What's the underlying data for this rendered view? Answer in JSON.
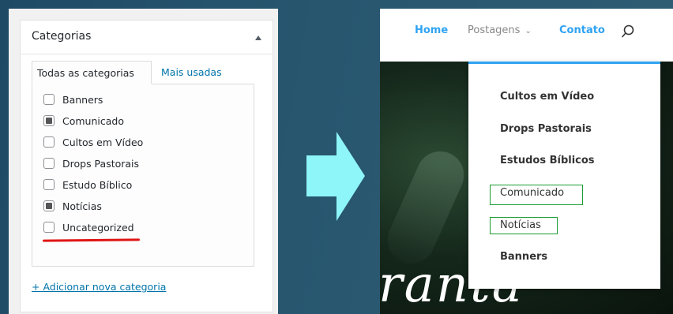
{
  "wp_panel": {
    "title": "Categorias",
    "tabs": [
      "Todas as categorias",
      "Mais usadas"
    ],
    "categories": [
      {
        "label": "Banners",
        "checked": false
      },
      {
        "label": "Comunicado",
        "checked": true
      },
      {
        "label": "Cultos em Vídeo",
        "checked": false
      },
      {
        "label": "Drops Pastorais",
        "checked": false
      },
      {
        "label": "Estudo Bíblico",
        "checked": false
      },
      {
        "label": "Notícias",
        "checked": true
      },
      {
        "label": "Uncategorized",
        "checked": false,
        "struck_out": true
      }
    ],
    "add_link": "+ Adicionar nova categoria"
  },
  "site": {
    "nav": {
      "home": "Home",
      "posts": "Postagens",
      "contact": "Contato"
    },
    "dropdown": [
      {
        "label": "Cultos em Vídeo",
        "highlighted": false
      },
      {
        "label": "Drops Pastorais",
        "highlighted": false
      },
      {
        "label": "Estudos Bíblicos",
        "highlighted": false
      },
      {
        "label": "Comunicado",
        "highlighted": true
      },
      {
        "label": "Notícias",
        "highlighted": true
      },
      {
        "label": "Banners",
        "highlighted": false
      }
    ],
    "hero_text": "ranta"
  },
  "colors": {
    "wp_link": "#0073aa",
    "strike": "#e01515",
    "arrow": "#8ef6f8",
    "nav_accent": "#2ea3f2",
    "highlight_box": "#1a9c33"
  },
  "icons": [
    "toggle-arrow-icon",
    "search-icon",
    "chevron-down-icon",
    "right-arrow-icon"
  ]
}
